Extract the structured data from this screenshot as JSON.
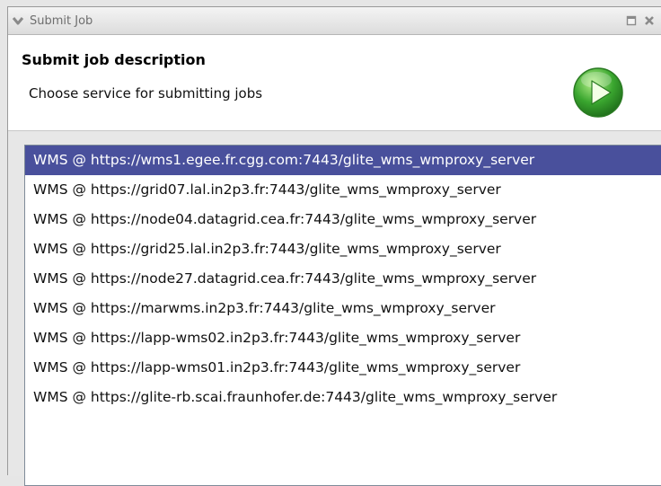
{
  "window": {
    "title": "Submit Job"
  },
  "header": {
    "heading": "Submit job description",
    "description": "Choose service for submitting jobs"
  },
  "services": {
    "selected_index": 0,
    "items": [
      "WMS @ https://wms1.egee.fr.cgg.com:7443/glite_wms_wmproxy_server",
      "WMS @ https://grid07.lal.in2p3.fr:7443/glite_wms_wmproxy_server",
      "WMS @ https://node04.datagrid.cea.fr:7443/glite_wms_wmproxy_server",
      "WMS @ https://grid25.lal.in2p3.fr:7443/glite_wms_wmproxy_server",
      "WMS @ https://node27.datagrid.cea.fr:7443/glite_wms_wmproxy_server",
      "WMS @ https://marwms.in2p3.fr:7443/glite_wms_wmproxy_server",
      "WMS @ https://lapp-wms02.in2p3.fr:7443/glite_wms_wmproxy_server",
      "WMS @ https://lapp-wms01.in2p3.fr:7443/glite_wms_wmproxy_server",
      "WMS @ https://glite-rb.scai.fraunhofer.de:7443/glite_wms_wmproxy_server"
    ]
  },
  "icons": {
    "collapse": "chevron-down-icon",
    "maximize": "maximize-icon",
    "close": "close-icon",
    "run": "play-icon"
  },
  "colors": {
    "selection": "#49509c",
    "run_icon": "#3aa62f"
  }
}
